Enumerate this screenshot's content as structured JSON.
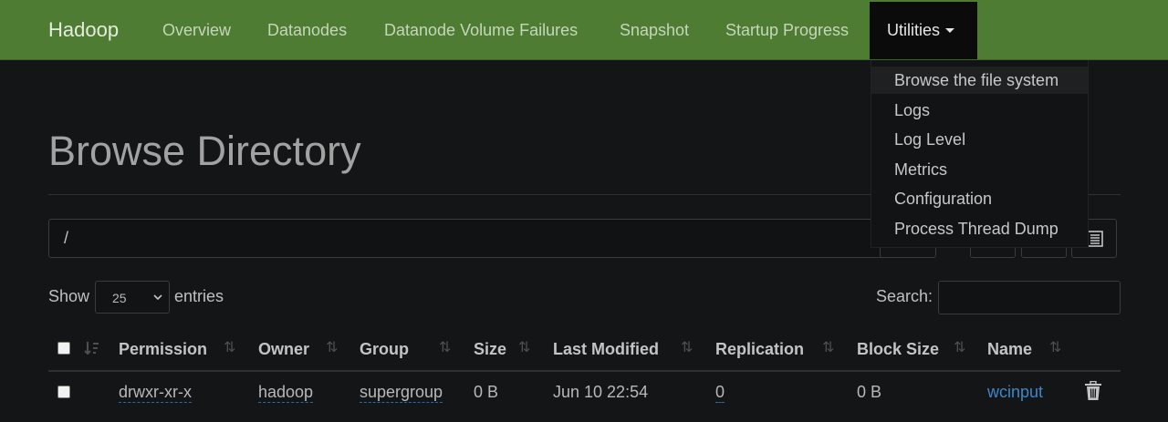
{
  "navbar": {
    "brand": "Hadoop",
    "items": [
      "Overview",
      "Datanodes",
      "Datanode Volume Failures",
      "Snapshot",
      "Startup Progress"
    ],
    "active": "Utilities",
    "accent_color": "#4e7c33"
  },
  "dropdown": {
    "items": [
      "Browse the file system",
      "Logs",
      "Log Level",
      "Metrics",
      "Configuration",
      "Process Thread Dump"
    ],
    "hovered": "Browse the file system"
  },
  "page": {
    "title": "Browse Directory",
    "path_value": "/"
  },
  "toolbar": {
    "icons": [
      "folder-icon",
      "upload-icon",
      "cut-icon",
      "paste-icon",
      "list-icon"
    ]
  },
  "controls": {
    "show_label": "Show",
    "entries_value": "25",
    "entries_label": "entries",
    "search_label": "Search:"
  },
  "table": {
    "columns": [
      "Permission",
      "Owner",
      "Group",
      "Size",
      "Last Modified",
      "Replication",
      "Block Size",
      "Name"
    ],
    "rows": [
      {
        "permission": "drwxr-xr-x",
        "owner": "hadoop",
        "group": "supergroup",
        "size": "0 B",
        "last_modified": "Jun 10 22:54",
        "replication": "0",
        "block_size": "0 B",
        "name": "wcinput"
      }
    ]
  }
}
